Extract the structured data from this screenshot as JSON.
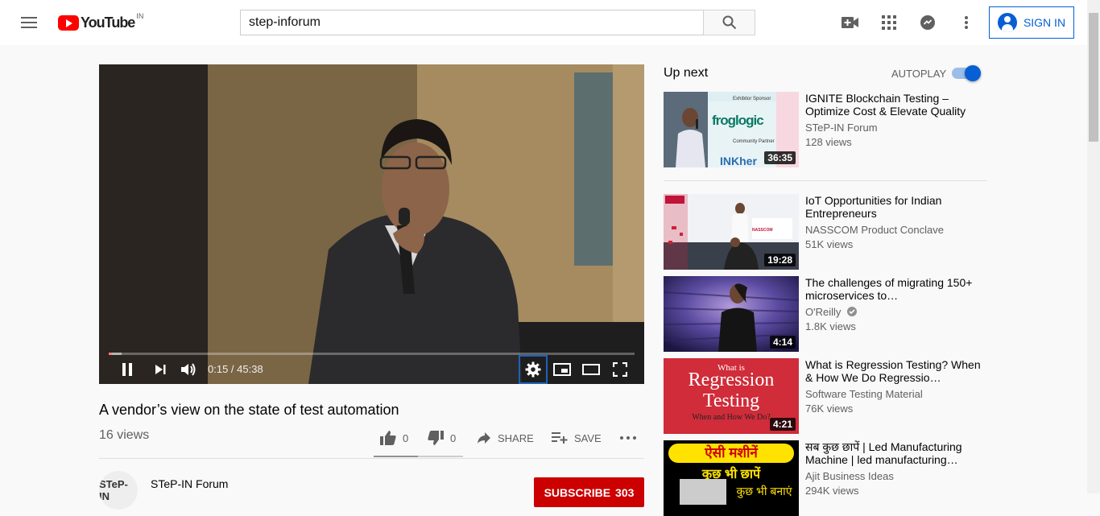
{
  "app": {
    "logo_text": "YouTube",
    "country_code": "IN"
  },
  "search": {
    "value": "step-inforum"
  },
  "header": {
    "signin_label": "SIGN IN"
  },
  "player": {
    "time_current": "0:15",
    "time_total": "45:38",
    "time_display": "0:15 / 45:38",
    "progress": 0.005
  },
  "video": {
    "title": "A vendor’s view on the state of test automation",
    "views": "16 views",
    "likes": "0",
    "dislikes": "0",
    "share_label": "SHARE",
    "save_label": "SAVE"
  },
  "channel": {
    "name": "STeP-IN Forum",
    "avatar_text": "STeP-IN",
    "subscribe_label": "SUBSCRIBE",
    "subscriber_count": "303"
  },
  "sidebar": {
    "up_next_label": "Up next",
    "autoplay_label": "AUTOPLAY",
    "autoplay_on": true,
    "items": [
      {
        "title": "IGNITE Blockchain Testing – Optimize Cost & Elevate Quality",
        "channel": "STeP-IN Forum",
        "views": "128 views",
        "duration": "36:35",
        "thumb_text": "froglogic",
        "thumb_sub": "Exhibitor Sponsor",
        "thumb_sub2": "Community Partner",
        "thumb_brand": "INKher"
      },
      {
        "title": "IoT Opportunities for Indian Entrepreneurs",
        "channel": "NASSCOM Product Conclave",
        "views": "51K views",
        "duration": "19:28",
        "thumb_text": "NASSCOM"
      },
      {
        "title": "The challenges of migrating 150+ microservices to…",
        "channel": "O'Reilly",
        "views": "1.8K views",
        "duration": "4:14",
        "verified": true
      },
      {
        "title": "What is Regression Testing? When & How We Do Regressio…",
        "channel": "Software Testing Material",
        "views": "76K views",
        "duration": "4:21",
        "thumb_small": "What is",
        "thumb_line1": "Regression",
        "thumb_line2": "Testing",
        "thumb_caption": "When and How We Do?"
      },
      {
        "title": "सब कुछ छापें | Led Manufacturing Machine | led manufacturing…",
        "channel": "Ajit Business Ideas",
        "views": "294K views",
        "thumb_line1": "ऐसी मशीनें",
        "thumb_line2": "कुछ भी छापें",
        "thumb_line3": "कुछ भी बनाएं"
      }
    ]
  },
  "colors": {
    "brand_red": "#ff0000",
    "accent_blue": "#065fd4",
    "subscribe_red": "#cc0000"
  }
}
